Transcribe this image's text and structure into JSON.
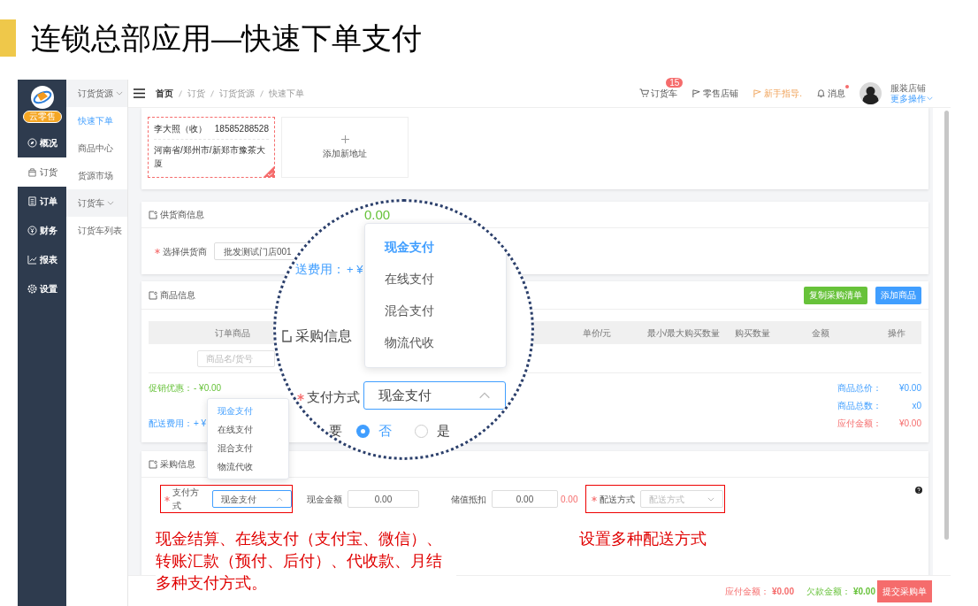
{
  "slide_title": "连锁总部应用—快速下单支付",
  "sidebar": {
    "badge": "云零售",
    "items": [
      {
        "label": "概况",
        "selected": false
      },
      {
        "label": "订货",
        "selected": true
      },
      {
        "label": "订单",
        "selected": false
      },
      {
        "label": "财务",
        "selected": false
      },
      {
        "label": "报表",
        "selected": false
      },
      {
        "label": "设置",
        "selected": false
      }
    ]
  },
  "subnav": [
    {
      "title": "订货货源",
      "expanded": true,
      "items": [
        {
          "label": "快速下单",
          "selected": true
        },
        {
          "label": "商品中心",
          "selected": false
        },
        {
          "label": "货源市场",
          "selected": false
        }
      ]
    },
    {
      "title": "订货车",
      "expanded": true,
      "items": [
        {
          "label": "订货车列表",
          "selected": false
        }
      ]
    }
  ],
  "breadcrumb": [
    "首页",
    "订货",
    "订货货源",
    "快速下单"
  ],
  "top_actions": [
    {
      "label": "订货车",
      "badge": "15",
      "highlighted": false,
      "unread": false
    },
    {
      "label": "零售店铺",
      "highlighted": false,
      "unread": false
    },
    {
      "label": "新手指导.",
      "highlighted": true,
      "unread": false
    },
    {
      "label": "消息",
      "highlighted": false,
      "unread": true
    }
  ],
  "user": {
    "name": "服装店铺",
    "menu": "更多操作"
  },
  "addresses": [
    {
      "name": "李大照（收）",
      "phone": "18585288528",
      "address": "河南省/郑州市/新郑市豫茶大厦",
      "selected": true
    }
  ],
  "add_address": "添加新地址",
  "supplier": {
    "title": "供货商信息",
    "label": "选择供货商",
    "required": true,
    "value": "批发测试门店001"
  },
  "goods": {
    "title": "商品信息",
    "buttons": [
      {
        "label": "复制采购清单",
        "color": "#67c23a"
      },
      {
        "label": "添加商品",
        "color": "#409eff"
      }
    ],
    "columns": [
      "订单商品",
      "单价/元",
      "最小/最大购买数量",
      "购买数量",
      "金额",
      "操作"
    ],
    "search_placeholder": "商品名/货号",
    "adjustments": [
      {
        "label": "促销优惠：",
        "value": "- ¥0.00",
        "kind": "discount"
      },
      {
        "label": "配送费用：",
        "value": "+ ¥",
        "kind": "fee"
      }
    ],
    "totals": [
      {
        "label": "商品总价：",
        "value": "¥0.00",
        "kind": "info"
      },
      {
        "label": "商品总数：",
        "value": "x0",
        "kind": "info"
      },
      {
        "label": "应付金额：",
        "value": "¥0.00",
        "kind": "due"
      }
    ]
  },
  "purchase": {
    "title": "采购信息",
    "payment": {
      "label": "支付方式",
      "required": true,
      "value": "现金支付",
      "open": true,
      "options": [
        {
          "label": "现金支付",
          "selected": true
        },
        {
          "label": "在线支付",
          "selected": false
        },
        {
          "label": "混合支付",
          "selected": false
        },
        {
          "label": "物流代收",
          "selected": false
        }
      ]
    },
    "cash": {
      "label": "现金金额",
      "value": "0.00"
    },
    "stored_value": {
      "label": "储值抵扣",
      "value": "0.00",
      "balance": "0.00"
    },
    "delivery": {
      "label": "配送方式",
      "required": true,
      "placeholder": "配送方式",
      "open": false
    }
  },
  "footer": {
    "payable_label": "应付金额：",
    "payable": "¥0.00",
    "debt_label": "欠款金额：",
    "debt": "¥0.00",
    "submit": "提交采购单"
  },
  "magnifier": {
    "amount": "0.00",
    "fee_label": "送费用：",
    "fee": "+ ¥",
    "section": "采购信息",
    "options": [
      {
        "label": "现金支付",
        "selected": true
      },
      {
        "label": "在线支付",
        "selected": false
      },
      {
        "label": "混合支付",
        "selected": false
      },
      {
        "label": "物流代收",
        "selected": false
      }
    ],
    "payment_label": "支付方式",
    "required": true,
    "payment_value": "现金支付",
    "open": true,
    "radio_label": "要",
    "radios": [
      {
        "label": "否",
        "selected": true
      },
      {
        "label": "是",
        "selected": false
      }
    ]
  },
  "annotations": [
    "现金结算、在线支付（支付宝、微信）、转账汇款（预付、后付）、代收款、月结多种支付方式。",
    "设置多种配送方式"
  ]
}
